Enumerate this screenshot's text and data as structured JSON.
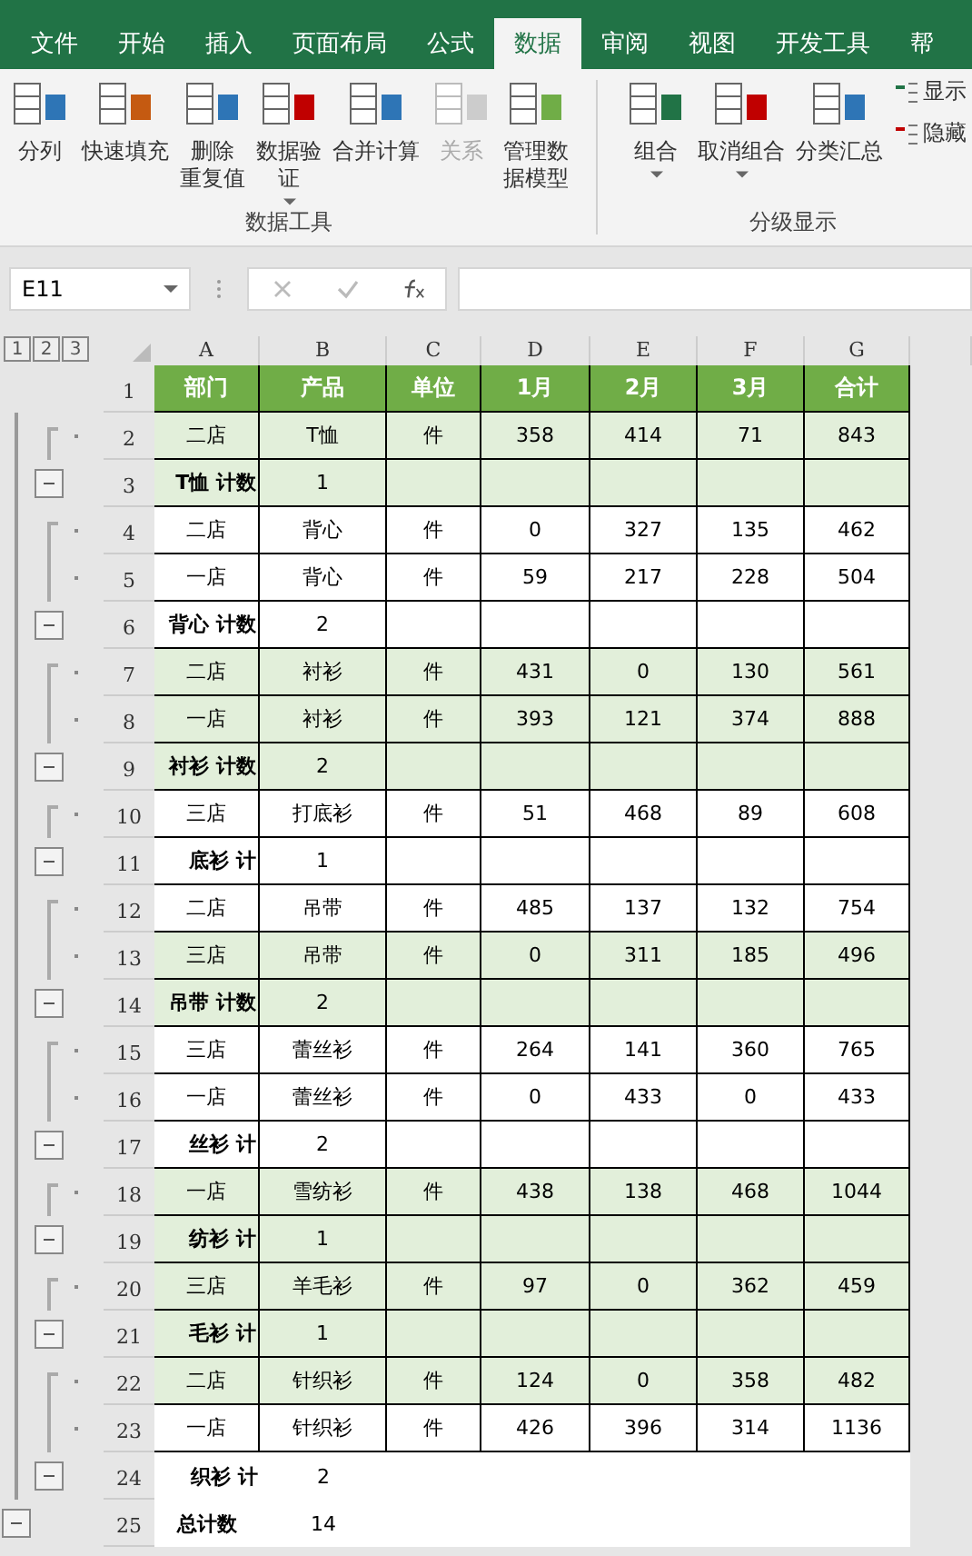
{
  "tabs": [
    {
      "label": "文件",
      "selected": false
    },
    {
      "label": "开始",
      "selected": false
    },
    {
      "label": "插入",
      "selected": false
    },
    {
      "label": "页面布局",
      "selected": false
    },
    {
      "label": "公式",
      "selected": false
    },
    {
      "label": "数据",
      "selected": true
    },
    {
      "label": "审阅",
      "selected": false
    },
    {
      "label": "视图",
      "selected": false
    },
    {
      "label": "开发工具",
      "selected": false
    },
    {
      "label": "帮",
      "selected": false
    }
  ],
  "ribbon_groups": [
    {
      "label": "数据工具",
      "buttons": [
        {
          "label": "分列",
          "disabled": false,
          "dropdown": false
        },
        {
          "label": "快速填充",
          "disabled": false,
          "dropdown": false
        },
        {
          "lines": [
            "删除",
            "重复值"
          ],
          "disabled": false,
          "dropdown": false
        },
        {
          "lines": [
            "数据验",
            "证"
          ],
          "disabled": false,
          "dropdown": true
        },
        {
          "label": "合并计算",
          "disabled": false,
          "dropdown": false
        },
        {
          "label": "关系",
          "disabled": true,
          "dropdown": false
        },
        {
          "lines": [
            "管理数",
            "据模型"
          ],
          "disabled": false,
          "dropdown": false
        }
      ]
    },
    {
      "label": "分级显示",
      "buttons": [
        {
          "label": "组合",
          "disabled": false,
          "dropdown": true
        },
        {
          "label": "取消组合",
          "disabled": false,
          "dropdown": true
        },
        {
          "label": "分类汇总",
          "disabled": false,
          "dropdown": false
        }
      ],
      "small_buttons": [
        "显示",
        "隐藏"
      ]
    }
  ],
  "name_box": "E11",
  "outline_levels": [
    "1",
    "2",
    "3"
  ],
  "columns": [
    "A",
    "B",
    "C",
    "D",
    "E",
    "F",
    "G"
  ],
  "rows": [
    {
      "number": "1",
      "kind": "header",
      "shaded": false,
      "bordered": true,
      "cells": [
        "部门",
        "产品",
        "单位",
        "1月",
        "2月",
        "3月",
        "合计"
      ]
    },
    {
      "number": "2",
      "kind": "detail",
      "shaded": true,
      "bordered": true,
      "cells": [
        "二店",
        "T恤",
        "件",
        "358",
        "414",
        "71",
        "843"
      ]
    },
    {
      "number": "3",
      "kind": "subtotal",
      "shaded": true,
      "bordered": true,
      "expanded": true,
      "cells": [
        "T恤 计数",
        "1"
      ]
    },
    {
      "number": "4",
      "kind": "detail",
      "shaded": false,
      "bordered": true,
      "cells": [
        "二店",
        "背心",
        "件",
        "0",
        "327",
        "135",
        "462"
      ]
    },
    {
      "number": "5",
      "kind": "detail",
      "shaded": false,
      "bordered": true,
      "cells": [
        "一店",
        "背心",
        "件",
        "59",
        "217",
        "228",
        "504"
      ]
    },
    {
      "number": "6",
      "kind": "subtotal",
      "shaded": false,
      "bordered": true,
      "expanded": true,
      "cells": [
        "背心 计数",
        "2"
      ]
    },
    {
      "number": "7",
      "kind": "detail",
      "shaded": true,
      "bordered": true,
      "cells": [
        "二店",
        "衬衫",
        "件",
        "431",
        "0",
        "130",
        "561"
      ]
    },
    {
      "number": "8",
      "kind": "detail",
      "shaded": true,
      "bordered": true,
      "cells": [
        "一店",
        "衬衫",
        "件",
        "393",
        "121",
        "374",
        "888"
      ]
    },
    {
      "number": "9",
      "kind": "subtotal",
      "shaded": true,
      "bordered": true,
      "expanded": true,
      "cells": [
        "衬衫 计数",
        "2"
      ]
    },
    {
      "number": "10",
      "kind": "detail",
      "shaded": false,
      "bordered": true,
      "cells": [
        "三店",
        "打底衫",
        "件",
        "51",
        "468",
        "89",
        "608"
      ]
    },
    {
      "number": "11",
      "kind": "subtotal",
      "shaded": false,
      "bordered": true,
      "expanded": true,
      "cells": [
        "底衫 计",
        "1"
      ]
    },
    {
      "number": "12",
      "kind": "detail",
      "shaded": false,
      "bordered": true,
      "cells": [
        "二店",
        "吊带",
        "件",
        "485",
        "137",
        "132",
        "754"
      ]
    },
    {
      "number": "13",
      "kind": "detail",
      "shaded": true,
      "bordered": true,
      "cells": [
        "三店",
        "吊带",
        "件",
        "0",
        "311",
        "185",
        "496"
      ]
    },
    {
      "number": "14",
      "kind": "subtotal",
      "shaded": true,
      "bordered": true,
      "expanded": true,
      "cells": [
        "吊带 计数",
        "2"
      ]
    },
    {
      "number": "15",
      "kind": "detail",
      "shaded": false,
      "bordered": true,
      "cells": [
        "三店",
        "蕾丝衫",
        "件",
        "264",
        "141",
        "360",
        "765"
      ]
    },
    {
      "number": "16",
      "kind": "detail",
      "shaded": false,
      "bordered": true,
      "cells": [
        "一店",
        "蕾丝衫",
        "件",
        "0",
        "433",
        "0",
        "433"
      ]
    },
    {
      "number": "17",
      "kind": "subtotal",
      "shaded": false,
      "bordered": true,
      "expanded": true,
      "cells": [
        "丝衫 计",
        "2"
      ]
    },
    {
      "number": "18",
      "kind": "detail",
      "shaded": true,
      "bordered": true,
      "cells": [
        "一店",
        "雪纺衫",
        "件",
        "438",
        "138",
        "468",
        "1044"
      ]
    },
    {
      "number": "19",
      "kind": "subtotal",
      "shaded": true,
      "bordered": true,
      "expanded": true,
      "cells": [
        "纺衫 计",
        "1"
      ]
    },
    {
      "number": "20",
      "kind": "detail",
      "shaded": true,
      "bordered": true,
      "cells": [
        "三店",
        "羊毛衫",
        "件",
        "97",
        "0",
        "362",
        "459"
      ]
    },
    {
      "number": "21",
      "kind": "subtotal",
      "shaded": true,
      "bordered": true,
      "expanded": true,
      "cells": [
        "毛衫 计",
        "1"
      ]
    },
    {
      "number": "22",
      "kind": "detail",
      "shaded": true,
      "bordered": true,
      "cells": [
        "二店",
        "针织衫",
        "件",
        "124",
        "0",
        "358",
        "482"
      ]
    },
    {
      "number": "23",
      "kind": "detail",
      "shaded": false,
      "bordered": true,
      "cells": [
        "一店",
        "针织衫",
        "件",
        "426",
        "396",
        "314",
        "1136"
      ]
    },
    {
      "number": "24",
      "kind": "subtotal",
      "shaded": false,
      "bordered": false,
      "expanded": true,
      "cells": [
        "织衫 计",
        "2"
      ]
    },
    {
      "number": "25",
      "kind": "total",
      "shaded": false,
      "bordered": false,
      "expanded": true,
      "cells": [
        "总计数",
        "14"
      ]
    }
  ]
}
